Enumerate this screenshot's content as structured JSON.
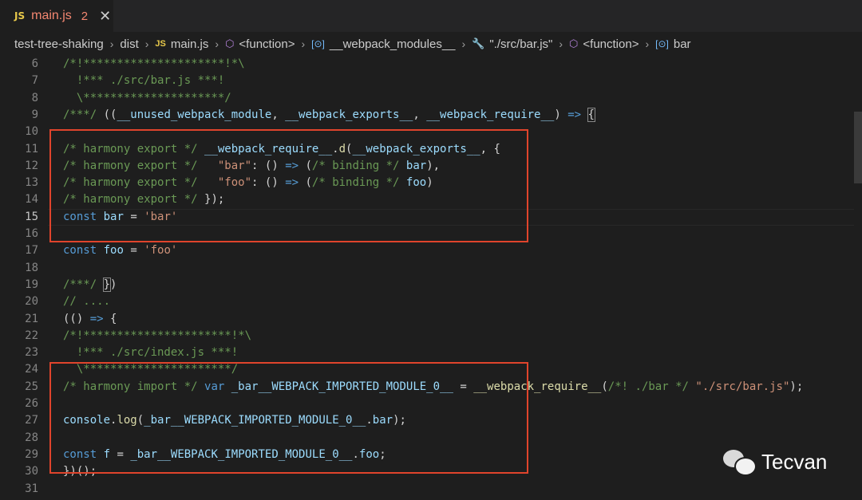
{
  "tab": {
    "badge": "JS",
    "title": "main.js",
    "problems": "2",
    "close": "✕"
  },
  "breadcrumb": [
    {
      "label": "test-tree-shaking",
      "icon": ""
    },
    {
      "label": "dist",
      "icon": ""
    },
    {
      "label": "main.js",
      "icon": "js"
    },
    {
      "label": "<function>",
      "icon": "cube"
    },
    {
      "label": "__webpack_modules__",
      "icon": "var"
    },
    {
      "label": "\"./src/bar.js\"",
      "icon": "wrench"
    },
    {
      "label": "<function>",
      "icon": "cube"
    },
    {
      "label": "bar",
      "icon": "var"
    }
  ],
  "current_line": 15,
  "lines": [
    {
      "n": "6",
      "tokens": [
        [
          "cm",
          "/*!*********************!*\\"
        ]
      ]
    },
    {
      "n": "7",
      "tokens": [
        [
          "cm",
          "  !*** ./src/bar.js ***!"
        ]
      ]
    },
    {
      "n": "8",
      "tokens": [
        [
          "cm",
          "  \\*********************/"
        ]
      ]
    },
    {
      "n": "9",
      "tokens": [
        [
          "cm",
          "/***/ "
        ],
        [
          "pl",
          "(("
        ],
        [
          "id",
          "__unused_webpack_module"
        ],
        [
          "pl",
          ", "
        ],
        [
          "id",
          "__webpack_exports__"
        ],
        [
          "pl",
          ", "
        ],
        [
          "id",
          "__webpack_require__"
        ],
        [
          "pl",
          ") "
        ],
        [
          "ar",
          "=>"
        ],
        [
          "pl",
          " "
        ],
        [
          "box",
          "{"
        ]
      ]
    },
    {
      "n": "10",
      "tokens": []
    },
    {
      "n": "11",
      "tokens": [
        [
          "cm",
          "/* harmony export */ "
        ],
        [
          "id",
          "__webpack_require__"
        ],
        [
          "pl",
          "."
        ],
        [
          "fn",
          "d"
        ],
        [
          "pl",
          "("
        ],
        [
          "id",
          "__webpack_exports__"
        ],
        [
          "pl",
          ", {"
        ]
      ]
    },
    {
      "n": "12",
      "tokens": [
        [
          "cm",
          "/* harmony export */   "
        ],
        [
          "st",
          "\"bar\""
        ],
        [
          "pl",
          ": () "
        ],
        [
          "ar",
          "=>"
        ],
        [
          "pl",
          " ("
        ],
        [
          "cm",
          "/* binding */"
        ],
        [
          "pl",
          " "
        ],
        [
          "id",
          "bar"
        ],
        [
          "pl",
          "),"
        ]
      ]
    },
    {
      "n": "13",
      "tokens": [
        [
          "cm",
          "/* harmony export */   "
        ],
        [
          "st",
          "\"foo\""
        ],
        [
          "pl",
          ": () "
        ],
        [
          "ar",
          "=>"
        ],
        [
          "pl",
          " ("
        ],
        [
          "cm",
          "/* binding */"
        ],
        [
          "pl",
          " "
        ],
        [
          "id",
          "foo"
        ],
        [
          "pl",
          ")"
        ]
      ]
    },
    {
      "n": "14",
      "tokens": [
        [
          "cm",
          "/* harmony export */ "
        ],
        [
          "pl",
          "});"
        ]
      ]
    },
    {
      "n": "15",
      "tokens": [
        [
          "kw",
          "const"
        ],
        [
          "pl",
          " "
        ],
        [
          "id",
          "bar"
        ],
        [
          "pl",
          " = "
        ],
        [
          "st",
          "'bar'"
        ]
      ]
    },
    {
      "n": "16",
      "tokens": []
    },
    {
      "n": "17",
      "tokens": [
        [
          "kw",
          "const"
        ],
        [
          "pl",
          " "
        ],
        [
          "id",
          "foo"
        ],
        [
          "pl",
          " = "
        ],
        [
          "st",
          "'foo'"
        ]
      ]
    },
    {
      "n": "18",
      "tokens": []
    },
    {
      "n": "19",
      "tokens": [
        [
          "cm",
          "/***/ "
        ],
        [
          "box",
          "}"
        ],
        [
          "pl",
          ")"
        ]
      ]
    },
    {
      "n": "20",
      "tokens": [
        [
          "cm",
          "// ...."
        ]
      ]
    },
    {
      "n": "21",
      "tokens": [
        [
          "pl",
          "(() "
        ],
        [
          "ar",
          "=>"
        ],
        [
          "pl",
          " {"
        ]
      ]
    },
    {
      "n": "22",
      "tokens": [
        [
          "cm",
          "/*!**********************!*\\"
        ]
      ]
    },
    {
      "n": "23",
      "tokens": [
        [
          "cm",
          "  !*** ./src/index.js ***!"
        ]
      ]
    },
    {
      "n": "24",
      "tokens": [
        [
          "cm",
          "  \\**********************/"
        ]
      ]
    },
    {
      "n": "25",
      "tokens": [
        [
          "cm",
          "/* harmony import */ "
        ],
        [
          "kw",
          "var"
        ],
        [
          "pl",
          " "
        ],
        [
          "id",
          "_bar__WEBPACK_IMPORTED_MODULE_0__"
        ],
        [
          "pl",
          " = "
        ],
        [
          "fn",
          "__webpack_require__"
        ],
        [
          "pl",
          "("
        ],
        [
          "cm",
          "/*! ./bar */"
        ],
        [
          "pl",
          " "
        ],
        [
          "st",
          "\"./src/bar.js\""
        ],
        [
          "pl",
          ");"
        ]
      ]
    },
    {
      "n": "26",
      "tokens": []
    },
    {
      "n": "27",
      "tokens": [
        [
          "id",
          "console"
        ],
        [
          "pl",
          "."
        ],
        [
          "fn",
          "log"
        ],
        [
          "pl",
          "("
        ],
        [
          "id",
          "_bar__WEBPACK_IMPORTED_MODULE_0__"
        ],
        [
          "pl",
          "."
        ],
        [
          "id",
          "bar"
        ],
        [
          "pl",
          ");"
        ]
      ]
    },
    {
      "n": "28",
      "tokens": []
    },
    {
      "n": "29",
      "tokens": [
        [
          "kw",
          "const"
        ],
        [
          "pl",
          " "
        ],
        [
          "id",
          "f"
        ],
        [
          "pl",
          " = "
        ],
        [
          "id",
          "_bar__WEBPACK_IMPORTED_MODULE_0__"
        ],
        [
          "pl",
          "."
        ],
        [
          "id",
          "foo"
        ],
        [
          "pl",
          ";"
        ]
      ]
    },
    {
      "n": "30",
      "tokens": [
        [
          "pl",
          "})();"
        ]
      ]
    },
    {
      "n": "31",
      "tokens": []
    }
  ],
  "watermark": {
    "text": "Tecvan"
  },
  "colors": {
    "highlight_box": "#e0442c",
    "tab_error": "#f48771"
  }
}
